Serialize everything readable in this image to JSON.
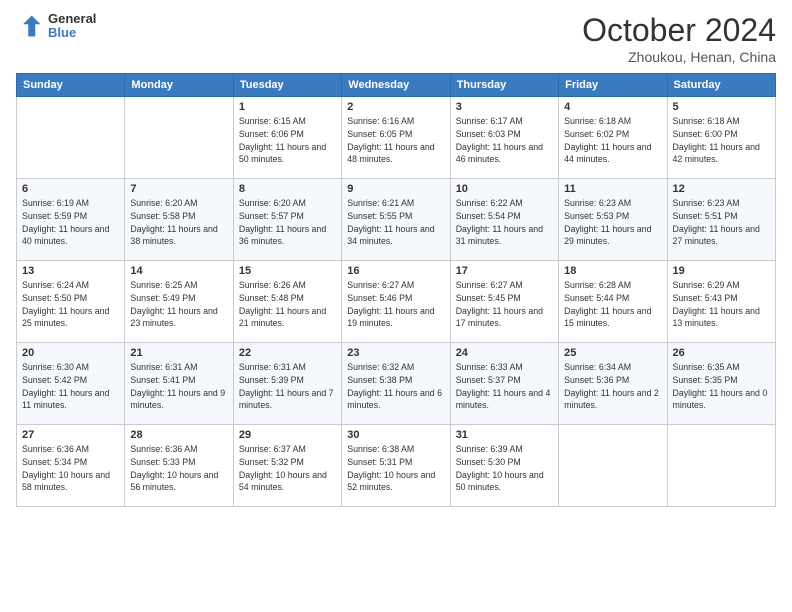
{
  "header": {
    "logo": {
      "line1": "General",
      "line2": "Blue"
    },
    "title": "October 2024",
    "subtitle": "Zhoukou, Henan, China"
  },
  "weekdays": [
    "Sunday",
    "Monday",
    "Tuesday",
    "Wednesday",
    "Thursday",
    "Friday",
    "Saturday"
  ],
  "weeks": [
    [
      {
        "day": "",
        "info": ""
      },
      {
        "day": "",
        "info": ""
      },
      {
        "day": "1",
        "info": "Sunrise: 6:15 AM\nSunset: 6:06 PM\nDaylight: 11 hours and 50 minutes."
      },
      {
        "day": "2",
        "info": "Sunrise: 6:16 AM\nSunset: 6:05 PM\nDaylight: 11 hours and 48 minutes."
      },
      {
        "day": "3",
        "info": "Sunrise: 6:17 AM\nSunset: 6:03 PM\nDaylight: 11 hours and 46 minutes."
      },
      {
        "day": "4",
        "info": "Sunrise: 6:18 AM\nSunset: 6:02 PM\nDaylight: 11 hours and 44 minutes."
      },
      {
        "day": "5",
        "info": "Sunrise: 6:18 AM\nSunset: 6:00 PM\nDaylight: 11 hours and 42 minutes."
      }
    ],
    [
      {
        "day": "6",
        "info": "Sunrise: 6:19 AM\nSunset: 5:59 PM\nDaylight: 11 hours and 40 minutes."
      },
      {
        "day": "7",
        "info": "Sunrise: 6:20 AM\nSunset: 5:58 PM\nDaylight: 11 hours and 38 minutes."
      },
      {
        "day": "8",
        "info": "Sunrise: 6:20 AM\nSunset: 5:57 PM\nDaylight: 11 hours and 36 minutes."
      },
      {
        "day": "9",
        "info": "Sunrise: 6:21 AM\nSunset: 5:55 PM\nDaylight: 11 hours and 34 minutes."
      },
      {
        "day": "10",
        "info": "Sunrise: 6:22 AM\nSunset: 5:54 PM\nDaylight: 11 hours and 31 minutes."
      },
      {
        "day": "11",
        "info": "Sunrise: 6:23 AM\nSunset: 5:53 PM\nDaylight: 11 hours and 29 minutes."
      },
      {
        "day": "12",
        "info": "Sunrise: 6:23 AM\nSunset: 5:51 PM\nDaylight: 11 hours and 27 minutes."
      }
    ],
    [
      {
        "day": "13",
        "info": "Sunrise: 6:24 AM\nSunset: 5:50 PM\nDaylight: 11 hours and 25 minutes."
      },
      {
        "day": "14",
        "info": "Sunrise: 6:25 AM\nSunset: 5:49 PM\nDaylight: 11 hours and 23 minutes."
      },
      {
        "day": "15",
        "info": "Sunrise: 6:26 AM\nSunset: 5:48 PM\nDaylight: 11 hours and 21 minutes."
      },
      {
        "day": "16",
        "info": "Sunrise: 6:27 AM\nSunset: 5:46 PM\nDaylight: 11 hours and 19 minutes."
      },
      {
        "day": "17",
        "info": "Sunrise: 6:27 AM\nSunset: 5:45 PM\nDaylight: 11 hours and 17 minutes."
      },
      {
        "day": "18",
        "info": "Sunrise: 6:28 AM\nSunset: 5:44 PM\nDaylight: 11 hours and 15 minutes."
      },
      {
        "day": "19",
        "info": "Sunrise: 6:29 AM\nSunset: 5:43 PM\nDaylight: 11 hours and 13 minutes."
      }
    ],
    [
      {
        "day": "20",
        "info": "Sunrise: 6:30 AM\nSunset: 5:42 PM\nDaylight: 11 hours and 11 minutes."
      },
      {
        "day": "21",
        "info": "Sunrise: 6:31 AM\nSunset: 5:41 PM\nDaylight: 11 hours and 9 minutes."
      },
      {
        "day": "22",
        "info": "Sunrise: 6:31 AM\nSunset: 5:39 PM\nDaylight: 11 hours and 7 minutes."
      },
      {
        "day": "23",
        "info": "Sunrise: 6:32 AM\nSunset: 5:38 PM\nDaylight: 11 hours and 6 minutes."
      },
      {
        "day": "24",
        "info": "Sunrise: 6:33 AM\nSunset: 5:37 PM\nDaylight: 11 hours and 4 minutes."
      },
      {
        "day": "25",
        "info": "Sunrise: 6:34 AM\nSunset: 5:36 PM\nDaylight: 11 hours and 2 minutes."
      },
      {
        "day": "26",
        "info": "Sunrise: 6:35 AM\nSunset: 5:35 PM\nDaylight: 11 hours and 0 minutes."
      }
    ],
    [
      {
        "day": "27",
        "info": "Sunrise: 6:36 AM\nSunset: 5:34 PM\nDaylight: 10 hours and 58 minutes."
      },
      {
        "day": "28",
        "info": "Sunrise: 6:36 AM\nSunset: 5:33 PM\nDaylight: 10 hours and 56 minutes."
      },
      {
        "day": "29",
        "info": "Sunrise: 6:37 AM\nSunset: 5:32 PM\nDaylight: 10 hours and 54 minutes."
      },
      {
        "day": "30",
        "info": "Sunrise: 6:38 AM\nSunset: 5:31 PM\nDaylight: 10 hours and 52 minutes."
      },
      {
        "day": "31",
        "info": "Sunrise: 6:39 AM\nSunset: 5:30 PM\nDaylight: 10 hours and 50 minutes."
      },
      {
        "day": "",
        "info": ""
      },
      {
        "day": "",
        "info": ""
      }
    ]
  ]
}
